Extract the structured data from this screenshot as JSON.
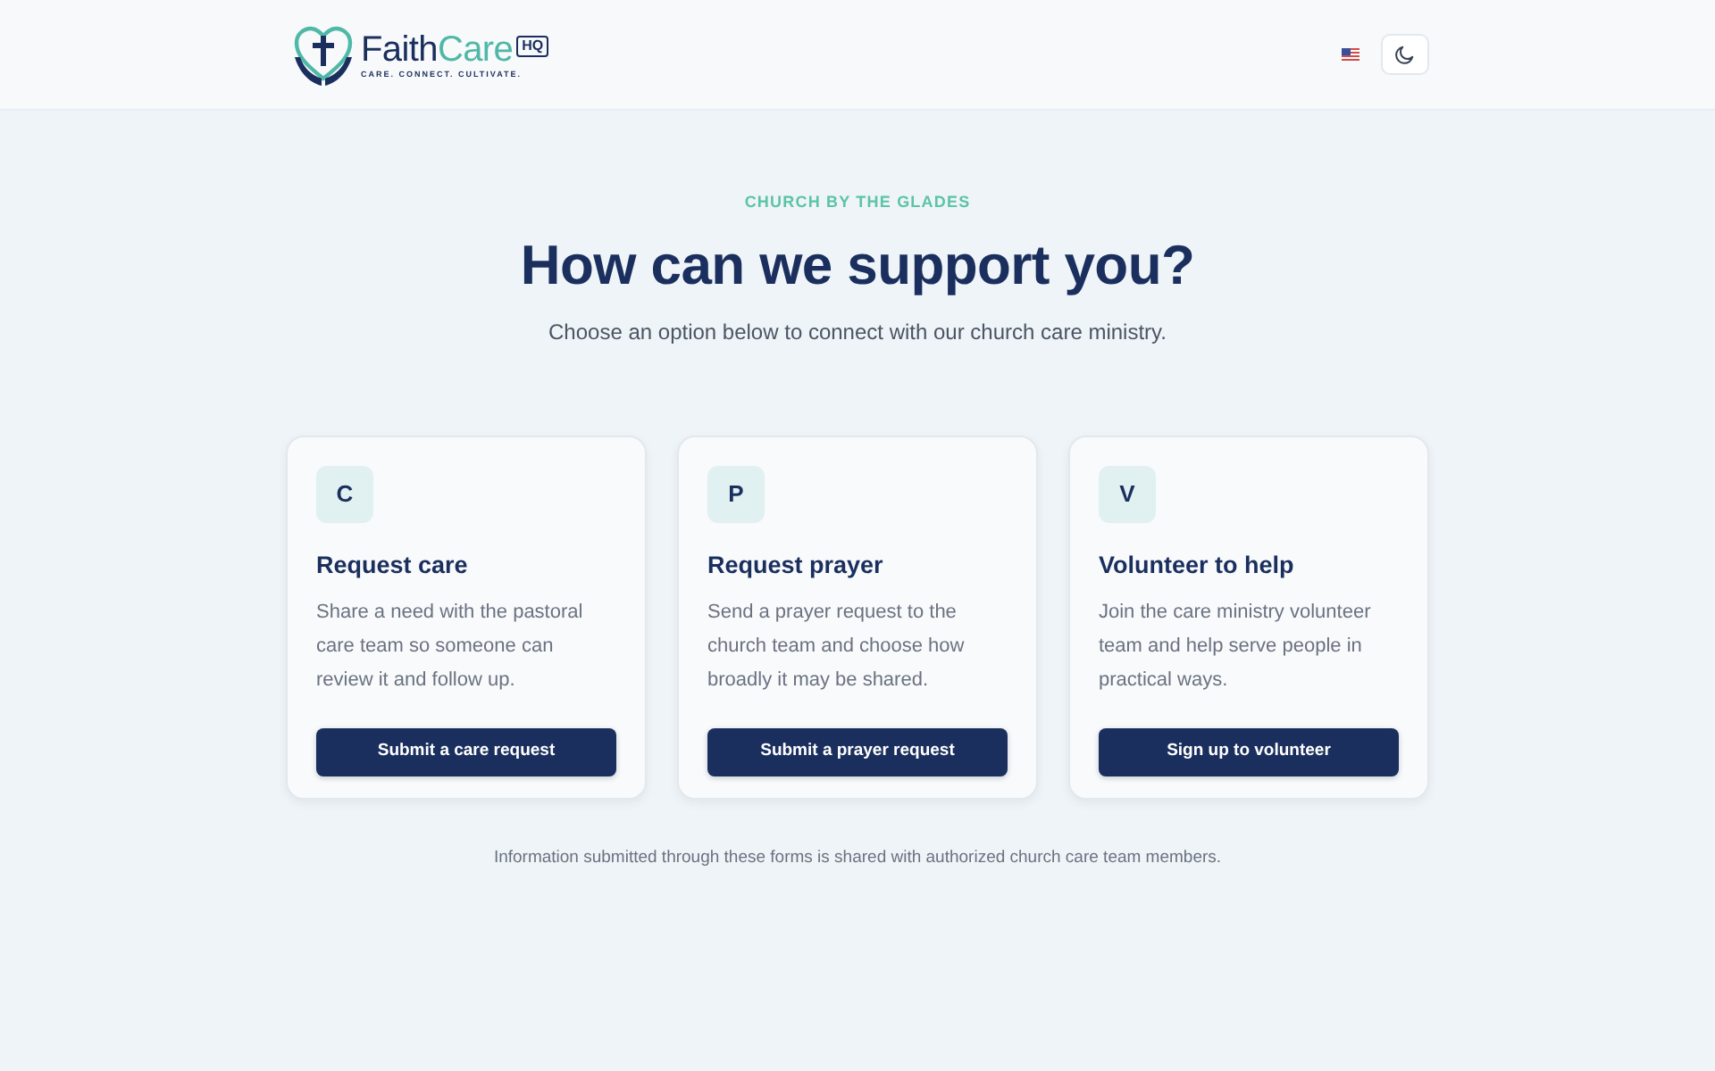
{
  "header": {
    "logo": {
      "name_start": "Faith",
      "name_end": "Care",
      "badge": "HQ",
      "tagline": "CARE. CONNECT. CULTIVATE."
    }
  },
  "hero": {
    "eyebrow": "CHURCH BY THE GLADES",
    "title": "How can we support you?",
    "subtitle": "Choose an option below to connect with our church care ministry."
  },
  "cards": [
    {
      "letter": "C",
      "title": "Request care",
      "description": "Share a need with the pastoral care team so someone can review it and follow up.",
      "button": "Submit a care request"
    },
    {
      "letter": "P",
      "title": "Request prayer",
      "description": "Send a prayer request to the church team and choose how broadly it may be shared.",
      "button": "Submit a prayer request"
    },
    {
      "letter": "V",
      "title": "Volunteer to help",
      "description": "Join the care ministry volunteer team and help serve people in practical ways.",
      "button": "Sign up to volunteer"
    }
  ],
  "footer_note": "Information submitted through these forms is shared with authorized church care team members."
}
